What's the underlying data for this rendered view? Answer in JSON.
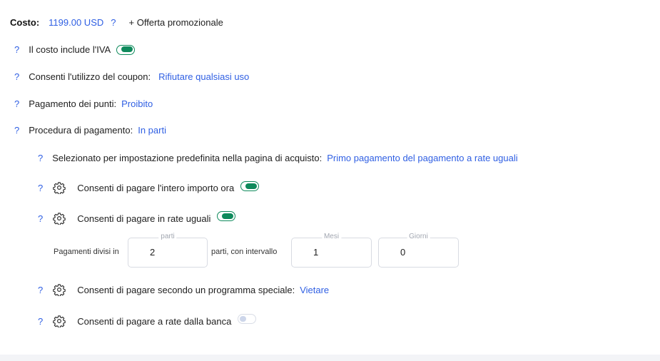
{
  "cost": {
    "label": "Costo:",
    "value": "1199.00 USD",
    "help": "?",
    "promo_link": "+ Offerta promozionale"
  },
  "vat": {
    "help": "?",
    "label": "Il costo include l'IVA",
    "enabled": true
  },
  "coupon": {
    "help": "?",
    "label": "Consenti l'utilizzo del coupon:",
    "value": "Rifiutare qualsiasi uso"
  },
  "points": {
    "help": "?",
    "label": "Pagamento dei punti:",
    "value": "Proibito"
  },
  "procedure": {
    "help": "?",
    "label": "Procedura di pagamento:",
    "value": "In parti"
  },
  "default_selected": {
    "help": "?",
    "label": "Selezionato per impostazione predefinita nella pagina di acquisto:",
    "value": "Primo pagamento del pagamento a rate uguali"
  },
  "full_now": {
    "help": "?",
    "icon": "gear-icon",
    "label": "Consenti di pagare l'intero importo ora",
    "enabled": true
  },
  "equal_installments": {
    "help": "?",
    "icon": "gear-icon",
    "label": "Consenti di pagare in rate uguali",
    "enabled": true,
    "divided_label": "Pagamenti divisi in",
    "parts_label": "parti",
    "parts_value": "2",
    "interval_label": "parti, con intervallo",
    "months_label": "Mesi",
    "months_value": "1",
    "days_label": "Giorni",
    "days_value": "0"
  },
  "special_schedule": {
    "help": "?",
    "icon": "gear-icon",
    "label": "Consenti di pagare secondo un programma speciale:",
    "value": "Vietare"
  },
  "bank_installments": {
    "help": "?",
    "icon": "gear-icon",
    "label": "Consenti di pagare a rate dalla banca",
    "enabled": false
  },
  "colors": {
    "accent": "#2f5fe3",
    "toggle_on": "#0f8a5c",
    "toggle_off": "#cdd6ea"
  }
}
